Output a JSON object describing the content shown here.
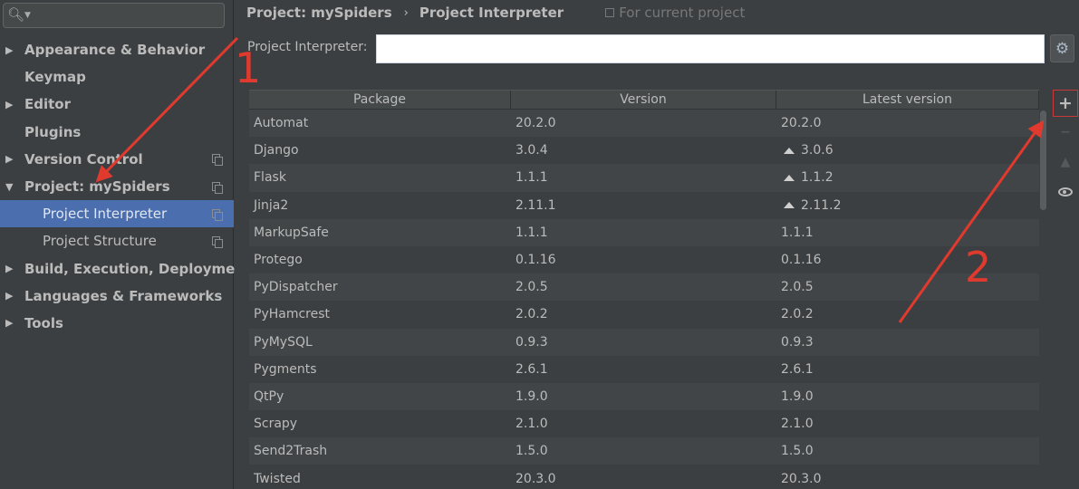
{
  "sidebar": {
    "items": [
      {
        "label": "Appearance & Behavior",
        "arrow": "▶"
      },
      {
        "label": "Keymap",
        "arrow": ""
      },
      {
        "label": "Editor",
        "arrow": "▶"
      },
      {
        "label": "Plugins",
        "arrow": ""
      },
      {
        "label": "Version Control",
        "arrow": "▶"
      },
      {
        "label": "Project: mySpiders",
        "arrow": "▼"
      },
      {
        "label": "Project Interpreter",
        "arrow": ""
      },
      {
        "label": "Project Structure",
        "arrow": ""
      },
      {
        "label": "Build, Execution, Deployment",
        "arrow": "▶"
      },
      {
        "label": "Languages & Frameworks",
        "arrow": "▶"
      },
      {
        "label": "Tools",
        "arrow": "▶"
      }
    ]
  },
  "breadcrumb": {
    "project": "Project: mySpiders",
    "separator": "›",
    "page": "Project Interpreter",
    "note": "For current project"
  },
  "interpreter": {
    "label": "Project Interpreter:",
    "value": ""
  },
  "table": {
    "headers": [
      "Package",
      "Version",
      "Latest version"
    ],
    "rows": [
      [
        "Automat",
        "20.2.0",
        "20.2.0",
        false
      ],
      [
        "Django",
        "3.0.4",
        "3.0.6",
        true
      ],
      [
        "Flask",
        "1.1.1",
        "1.1.2",
        true
      ],
      [
        "Jinja2",
        "2.11.1",
        "2.11.2",
        true
      ],
      [
        "MarkupSafe",
        "1.1.1",
        "1.1.1",
        false
      ],
      [
        "Protego",
        "0.1.16",
        "0.1.16",
        false
      ],
      [
        "PyDispatcher",
        "2.0.5",
        "2.0.5",
        false
      ],
      [
        "PyHamcrest",
        "2.0.2",
        "2.0.2",
        false
      ],
      [
        "PyMySQL",
        "0.9.3",
        "0.9.3",
        false
      ],
      [
        "Pygments",
        "2.6.1",
        "2.6.1",
        false
      ],
      [
        "QtPy",
        "1.9.0",
        "1.9.0",
        false
      ],
      [
        "Scrapy",
        "2.1.0",
        "2.1.0",
        false
      ],
      [
        "Send2Trash",
        "1.5.0",
        "1.5.0",
        false
      ],
      [
        "Twisted",
        "20.3.0",
        "20.3.0",
        false
      ]
    ]
  },
  "tools": {
    "add": "+",
    "remove": "−",
    "upgrade": "▲"
  },
  "annotations": {
    "step1": "1",
    "step2": "2",
    "color": "#e03a2f"
  },
  "colors": {
    "selection": "#4b6eaf",
    "background": "#3c3f41"
  }
}
